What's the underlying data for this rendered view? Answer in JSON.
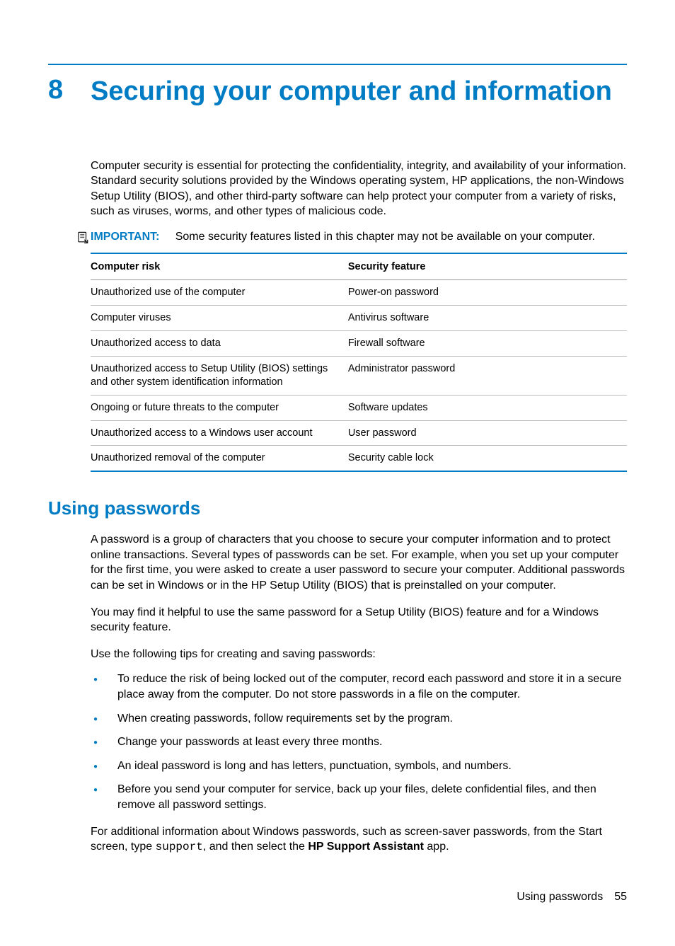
{
  "chapter": {
    "number": "8",
    "title": "Securing your computer and information"
  },
  "intro": "Computer security is essential for protecting the confidentiality, integrity, and availability of your information. Standard security solutions provided by the Windows operating system, HP applications, the non-Windows Setup Utility (BIOS), and other third-party software can help protect your computer from a variety of risks, such as viruses, worms, and other types of malicious code.",
  "note": {
    "label": "IMPORTANT:",
    "text": "Some security features listed in this chapter may not be available on your computer."
  },
  "table": {
    "headers": {
      "col1": "Computer risk",
      "col2": "Security feature"
    },
    "rows": [
      {
        "risk": "Unauthorized use of the computer",
        "feature": "Power-on password"
      },
      {
        "risk": "Computer viruses",
        "feature": "Antivirus software"
      },
      {
        "risk": "Unauthorized access to data",
        "feature": "Firewall software"
      },
      {
        "risk": "Unauthorized access to Setup Utility (BIOS) settings and other system identification information",
        "feature": "Administrator password"
      },
      {
        "risk": "Ongoing or future threats to the computer",
        "feature": "Software updates"
      },
      {
        "risk": "Unauthorized access to a Windows user account",
        "feature": "User password"
      },
      {
        "risk": "Unauthorized removal of the computer",
        "feature": "Security cable lock"
      }
    ]
  },
  "section": {
    "heading": "Using passwords",
    "p1": "A password is a group of characters that you choose to secure your computer information and to protect online transactions. Several types of passwords can be set. For example, when you set up your computer for the first time, you were asked to create a user password to secure your computer. Additional passwords can be set in Windows or in the HP Setup Utility (BIOS) that is preinstalled on your computer.",
    "p2": "You may find it helpful to use the same password for a Setup Utility (BIOS) feature and for a Windows security feature.",
    "p3": "Use the following tips for creating and saving passwords:",
    "tips": [
      "To reduce the risk of being locked out of the computer, record each password and store it in a secure place away from the computer. Do not store passwords in a file on the computer.",
      "When creating passwords, follow requirements set by the program.",
      "Change your passwords at least every three months.",
      "An ideal password is long and has letters, punctuation, symbols, and numbers.",
      "Before you send your computer for service, back up your files, delete confidential files, and then remove all password settings."
    ],
    "p4_pre": "For additional information about Windows passwords, such as screen-saver passwords, from the Start screen, type ",
    "p4_code": "support",
    "p4_mid": ", and then select the ",
    "p4_bold": "HP Support Assistant",
    "p4_post": " app."
  },
  "footer": {
    "label": "Using passwords",
    "page": "55"
  }
}
